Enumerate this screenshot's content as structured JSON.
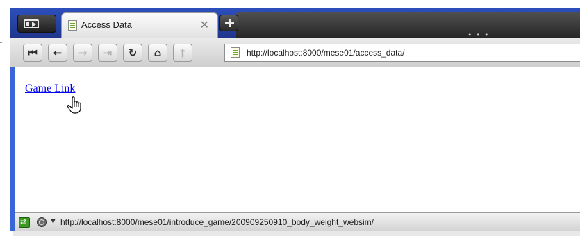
{
  "browser": {
    "tab": {
      "title": "Access Data",
      "close_glyph": "✕"
    },
    "toolbar": {
      "first_glyph": "⏮",
      "back_glyph": "←",
      "forward_glyph": "→",
      "last_glyph": "⇥",
      "reload_glyph": "↻",
      "home_glyph": "⌂",
      "bookmark_glyph": "†"
    },
    "address_bar": {
      "url": "http://localhost:8000/mese01/access_data/"
    },
    "status_bar": {
      "text": "http://localhost:8000/mese01/introduce_game/200909250910_body_weight_websim/"
    }
  },
  "page": {
    "links": [
      {
        "text": "Game Link"
      }
    ]
  },
  "icons": [
    "sidebar-toggle-icon",
    "page-icon",
    "close-icon",
    "new-tab-icon",
    "first-page-icon",
    "back-icon",
    "forward-icon",
    "last-page-icon",
    "reload-icon",
    "home-icon",
    "bookmark-icon",
    "sync-icon",
    "globe-icon",
    "hand-cursor-icon"
  ],
  "colors": {
    "frame_blue": "#3a65d9",
    "link": "#0000ee",
    "tabbar_dark": "#262626"
  }
}
